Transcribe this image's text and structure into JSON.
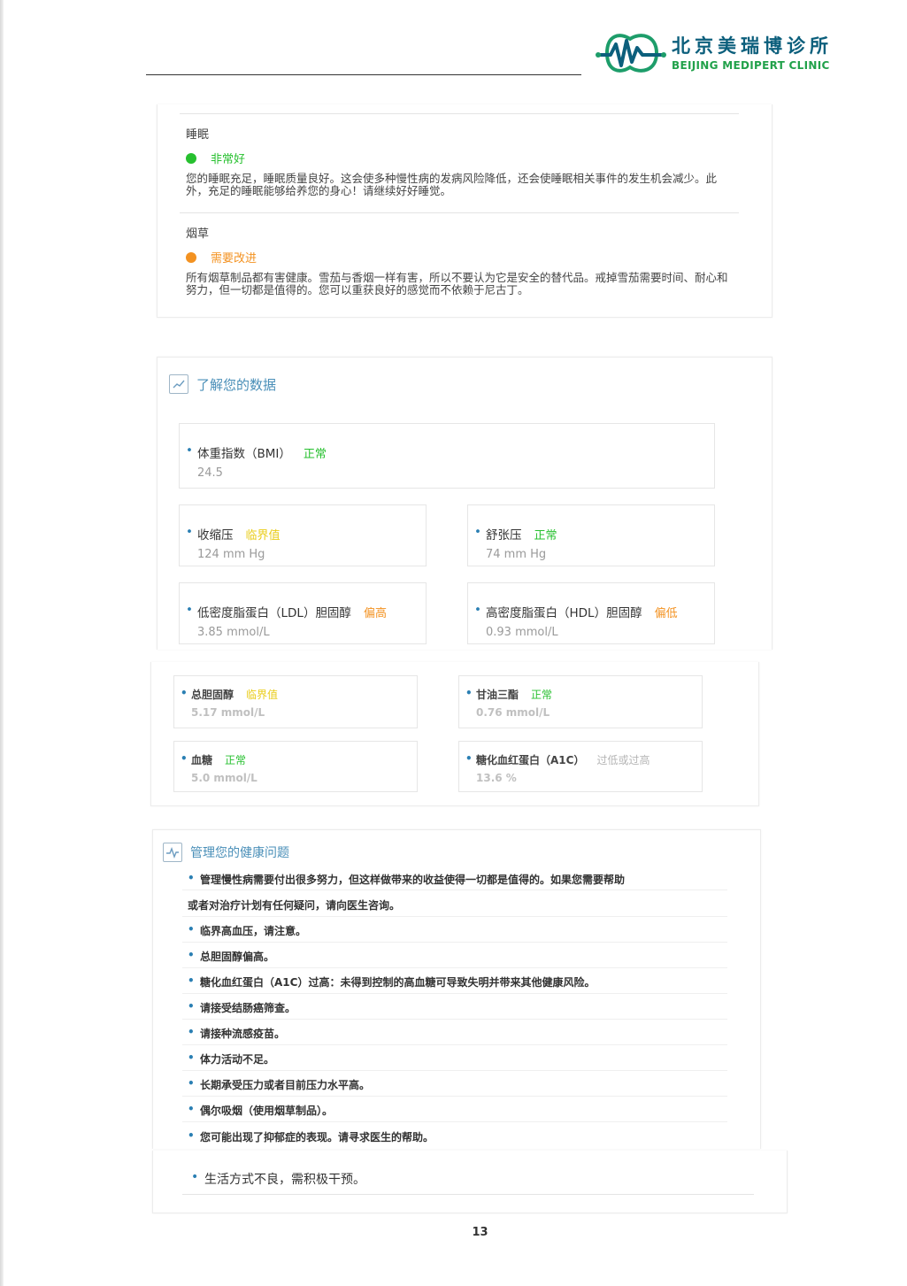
{
  "logo": {
    "name_cn": "北京美瑞博诊所",
    "name_en": "BEIJING MEDIPERT CLINIC"
  },
  "colors": {
    "green": "#27c02f",
    "orange": "#f39221",
    "yellow": "#e9cc18",
    "blue": "#4a8fb8",
    "gray": "#b5b5b5"
  },
  "lifestyle": {
    "sleep": {
      "title": "睡眠",
      "status": "非常好",
      "text": "您的睡眠充足，睡眠质量良好。这会使多种慢性病的发病风险降低，还会使睡眠相关事件的发生机会减少。此外，充足的睡眠能够给养您的身心！请继续好好睡觉。"
    },
    "tobacco": {
      "title": "烟草",
      "status": "需要改进",
      "text": "所有烟草制品都有害健康。雪茄与香烟一样有害，所以不要认为它是安全的替代品。戒掉雪茄需要时间、耐心和努力，但一切都是值得的。您可以重获良好的感觉而不依赖于尼古丁。"
    }
  },
  "know_data": {
    "title": "了解您的数据",
    "metrics": [
      {
        "name": "体重指数（BMI）",
        "status": "正常",
        "value": "24.5"
      },
      {
        "name": "收缩压",
        "status": "临界值",
        "value": "124 mm Hg"
      },
      {
        "name": "舒张压",
        "status": "正常",
        "value": "74 mm Hg"
      },
      {
        "name": "低密度脂蛋白（LDL）胆固醇",
        "status": "偏高",
        "value": "3.85 mmol/L"
      },
      {
        "name": "高密度脂蛋白（HDL）胆固醇",
        "status": "偏低",
        "value": "0.93 mmol/L"
      },
      {
        "name": "总胆固醇",
        "status": "临界值",
        "value": "5.17 mmol/L"
      },
      {
        "name": "甘油三酯",
        "status": "正常",
        "value": "0.76 mmol/L"
      },
      {
        "name": "血糖",
        "status": "正常",
        "value": "5.0 mmol/L"
      },
      {
        "name": "糖化血红蛋白（A1C）",
        "status": "过低或过高",
        "value": "13.6 %"
      }
    ]
  },
  "manage": {
    "title": "管理您的健康问题",
    "intro_line1": "管理慢性病需要付出很多努力，但这样做带来的收益使得一切都是值得的。如果您需要帮助",
    "intro_line2": "或者对治疗计划有任何疑问，请向医生咨询。",
    "items": [
      "临界高血压，请注意。",
      "总胆固醇偏高。",
      "糖化血红蛋白（A1C）过高：未得到控制的高血糖可导致失明并带来其他健康风险。",
      "请接受结肠癌筛查。",
      "请接种流感疫苗。",
      "体力活动不足。",
      "长期承受压力或者目前压力水平高。",
      "偶尔吸烟（使用烟草制品）。",
      "您可能出现了抑郁症的表现。请寻求医生的帮助。"
    ],
    "last_item": "生活方式不良，需积极干预。"
  },
  "page_number": "13"
}
